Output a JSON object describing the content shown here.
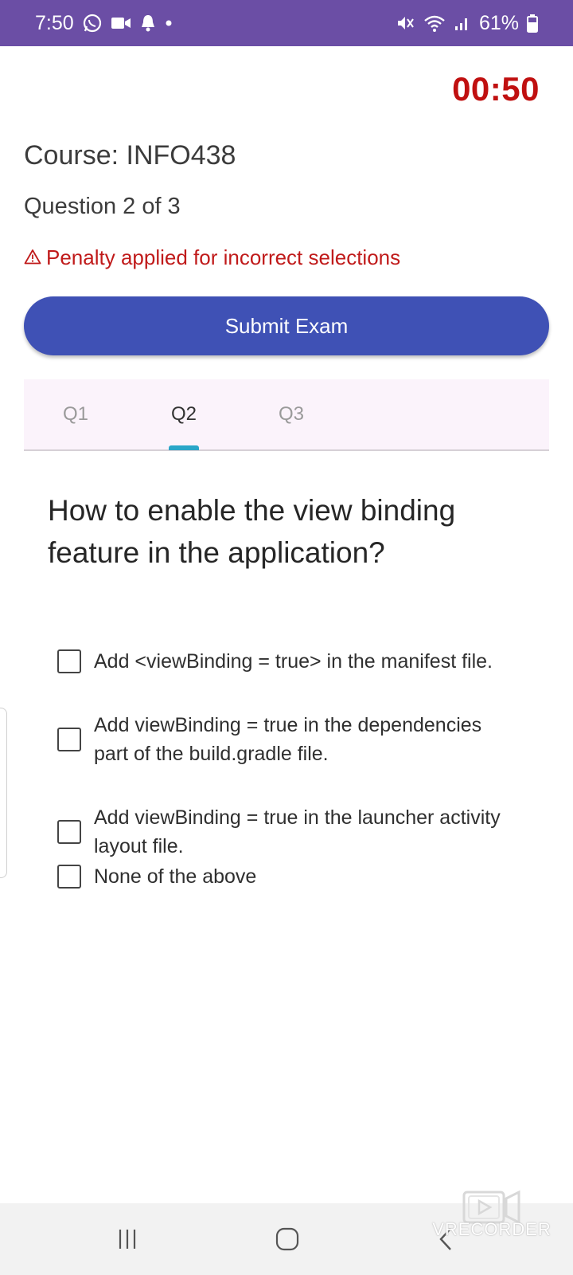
{
  "status_bar": {
    "time": "7:50",
    "left_icons": [
      "whatsapp-icon",
      "video-call-icon",
      "notification-bell-icon",
      "dot-icon"
    ],
    "right_icons": [
      "mute-icon",
      "wifi-icon",
      "signal-icon",
      "battery-icon"
    ],
    "battery_percent": "61%",
    "color": "#6b4ea5"
  },
  "timer": "00:50",
  "course": "Course: INFO438",
  "question_count": "Question 2 of 3",
  "penalty": {
    "icon": "warning-icon",
    "text": "Penalty applied for incorrect selections"
  },
  "submit_button": "Submit Exam",
  "tabs": [
    {
      "label": "Q1",
      "active": false
    },
    {
      "label": "Q2",
      "active": true
    },
    {
      "label": "Q3",
      "active": false
    }
  ],
  "question": "How to enable the view binding feature in the application?",
  "options": [
    {
      "text": "Add <viewBinding = true> in the manifest file.",
      "checked": false
    },
    {
      "text": "Add viewBinding = true in the dependencies part of the build.gradle file.",
      "checked": false
    },
    {
      "text": "Add viewBinding = true in the launcher activity layout file.",
      "checked": false
    },
    {
      "text": "None of the above",
      "checked": false
    }
  ],
  "watermark": "VRECORDER",
  "colors": {
    "accent": "#3f51b5",
    "timer": "#c01010",
    "penalty": "#c01a1a",
    "tab_indicator": "#2aa6c8"
  }
}
